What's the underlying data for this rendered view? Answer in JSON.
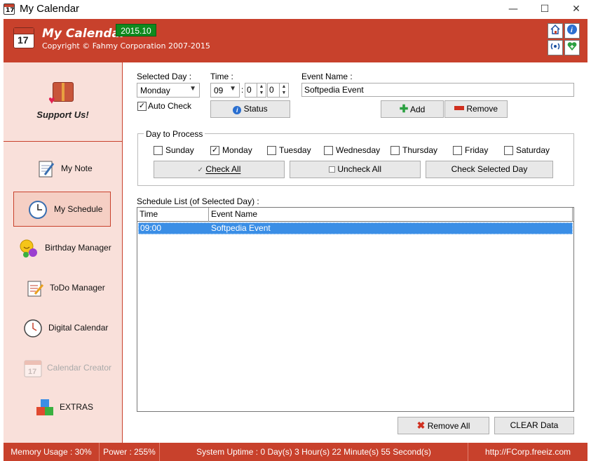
{
  "window": {
    "title": "My Calendar",
    "minimize": "—",
    "maximize": "☐",
    "close": "✕"
  },
  "header": {
    "app_name": "My Calendar",
    "version": "2015.10",
    "copyright": "Copyright © Fahmy Corporation 2007-2015",
    "icon_day": "17"
  },
  "sidebar": {
    "support_label": "Support Us!",
    "items": [
      {
        "label": "My Note",
        "icon": "note-icon"
      },
      {
        "label": "My Schedule",
        "icon": "clock-icon"
      },
      {
        "label": "Birthday Manager",
        "icon": "smiley-icon"
      },
      {
        "label": "ToDo Manager",
        "icon": "todo-icon"
      },
      {
        "label": "Digital Calendar",
        "icon": "digital-clock-icon"
      },
      {
        "label": "Calendar Creator",
        "icon": "calendar-icon"
      },
      {
        "label": "EXTRAS",
        "icon": "cubes-icon"
      }
    ],
    "active": "My Schedule",
    "disabled": "Calendar Creator"
  },
  "form": {
    "selected_day_label": "Selected Day :",
    "selected_day_value": "Monday",
    "time_label": "Time :",
    "hour_value": "09",
    "minute_value": "0",
    "second_value": "0",
    "time_sep": ":",
    "event_name_label": "Event Name :",
    "event_name_value": "Softpedia Event",
    "auto_check_label": "Auto Check",
    "auto_check": true,
    "status_button": "Status",
    "add_button": "Add",
    "remove_button": "Remove"
  },
  "day_group": {
    "legend": "Day to Process",
    "days": [
      {
        "label": "Sunday",
        "checked": false
      },
      {
        "label": "Monday",
        "checked": true
      },
      {
        "label": "Tuesday",
        "checked": false
      },
      {
        "label": "Wednesday",
        "checked": false
      },
      {
        "label": "Thursday",
        "checked": false
      },
      {
        "label": "Friday",
        "checked": false
      },
      {
        "label": "Saturday",
        "checked": false
      }
    ],
    "check_all": "Check All",
    "uncheck_all": "Uncheck All",
    "check_selected": "Check Selected Day"
  },
  "schedule": {
    "label": "Schedule List (of Selected Day) :",
    "columns": [
      "Time",
      "Event Name"
    ],
    "rows": [
      {
        "time": "09:00",
        "event": "Softpedia Event"
      }
    ]
  },
  "footer_buttons": {
    "remove_all": "Remove All",
    "clear_data": "CLEAR Data"
  },
  "statusbar": {
    "memory": "Memory Usage : 30%",
    "power": "Power : 255%",
    "uptime": "System Uptime : 0 Day(s) 3 Hour(s) 22 Minute(s) 55 Second(s)",
    "url": "http://FCorp.freeiz.com"
  },
  "colors": {
    "accent": "#c8412c",
    "sidebar_bg": "#f9e0da",
    "selection": "#3a8ee6",
    "version_badge": "#0f8a1e"
  }
}
